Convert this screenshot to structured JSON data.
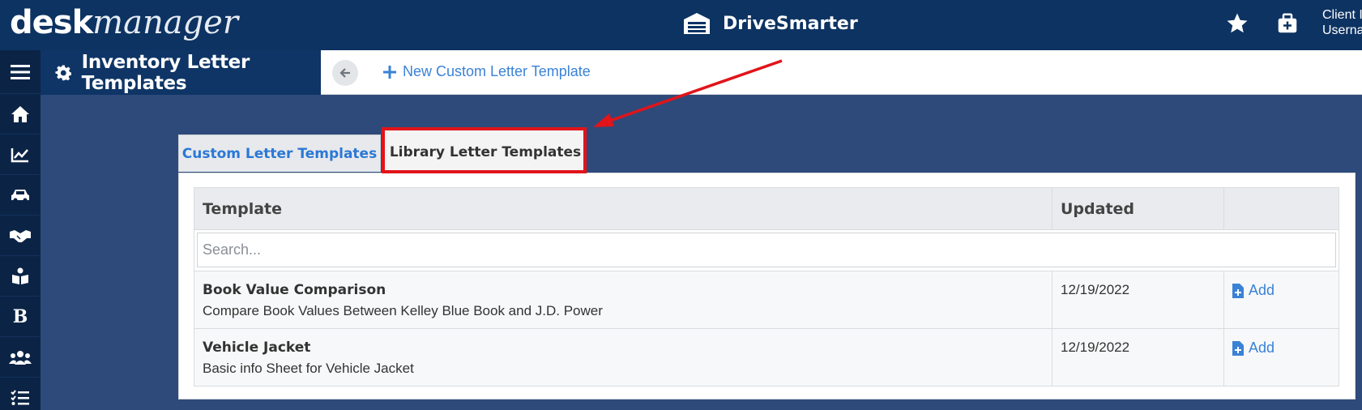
{
  "topbar": {
    "logo_bold": "desk",
    "logo_italic": "manager",
    "brand_name": "DriveSmarter",
    "client_line1": "Client I",
    "client_line2": "Userna",
    "icons": [
      "star-icon",
      "medical-kit-icon",
      "garage-icon"
    ]
  },
  "sidebar": {
    "items": [
      "menu-icon",
      "home-icon",
      "chart-icon",
      "car-icon",
      "handshake-icon",
      "reading-icon",
      "bold-b-icon",
      "users-icon",
      "checklist-icon"
    ]
  },
  "page_header": {
    "title": "Inventory Letter Templates",
    "new_template_label": "New Custom Letter Template"
  },
  "tabs": [
    {
      "label": "Custom Letter Templates",
      "active": false
    },
    {
      "label": "Library Letter Templates",
      "active": true
    }
  ],
  "table": {
    "headers": {
      "template": "Template",
      "updated": "Updated",
      "actions": ""
    },
    "search_placeholder": "Search...",
    "rows": [
      {
        "name": "Book Value Comparison",
        "description": "Compare Book Values Between Kelley Blue Book and J.D. Power",
        "updated": "12/19/2022",
        "action": "Add"
      },
      {
        "name": "Vehicle Jacket",
        "description": "Basic info Sheet for Vehicle Jacket",
        "updated": "12/19/2022",
        "action": "Add"
      }
    ]
  },
  "colors": {
    "topbar": "#0d3362",
    "sidebar": "#0b2446",
    "background": "#2e4a7a",
    "link": "#3a82d6",
    "annotation": "#e1141a"
  }
}
